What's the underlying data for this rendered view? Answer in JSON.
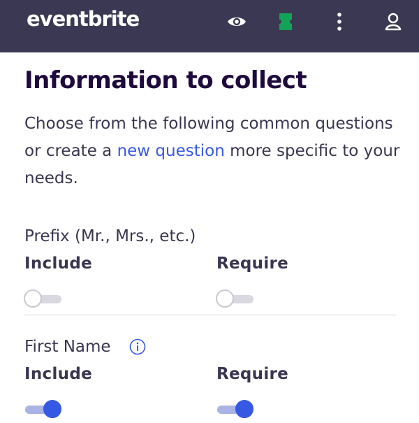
{
  "header": {
    "logo_text": "eventbrite",
    "icons": [
      "eye-icon",
      "ticket-icon",
      "more-vertical-icon",
      "user-icon"
    ],
    "background_color": "#3a3852",
    "ticket_icon_color": "#12a356"
  },
  "main": {
    "title": "Information to collect",
    "description_before": "Choose from the following common questions or create a ",
    "description_link": "new question",
    "description_after": " more specific to your needs."
  },
  "questions": [
    {
      "label": "Prefix (Mr., Mrs., etc.)",
      "include_label": "Include",
      "require_label": "Require",
      "include_on": false,
      "require_on": false
    },
    {
      "label": "First Name",
      "info_icon": "info-icon",
      "include_label": "Include",
      "require_label": "Require",
      "include_on": true,
      "require_on": true
    }
  ],
  "colors": {
    "accent": "#3659e3",
    "title": "#1e0a3c"
  }
}
